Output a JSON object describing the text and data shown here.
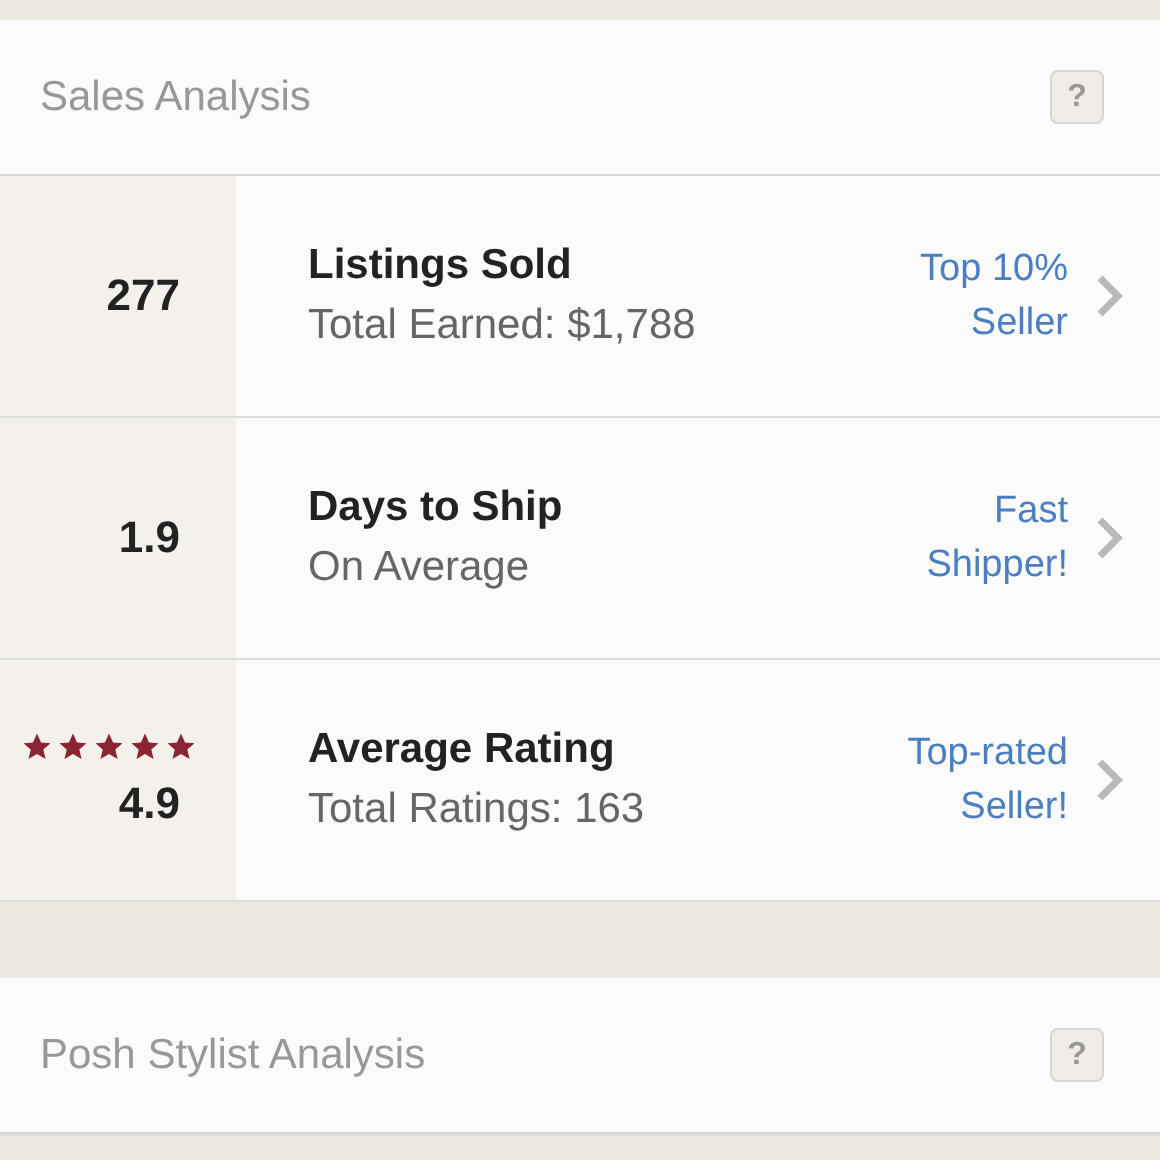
{
  "sections": [
    {
      "title": "Sales Analysis",
      "help": "?",
      "rows": [
        {
          "value": "277",
          "title": "Listings Sold",
          "subtitle": "Total Earned: $1,788",
          "badge": [
            "Top 10%",
            "Seller"
          ]
        },
        {
          "value": "1.9",
          "title": "Days to Ship",
          "subtitle": "On Average",
          "badge": [
            "Fast",
            "Shipper!"
          ]
        },
        {
          "value": "4.9",
          "stars": 5,
          "title": "Average Rating",
          "subtitle": "Total Ratings: 163",
          "badge": [
            "Top-rated",
            "Seller!"
          ]
        }
      ]
    },
    {
      "title": "Posh Stylist Analysis",
      "help": "?"
    }
  ]
}
